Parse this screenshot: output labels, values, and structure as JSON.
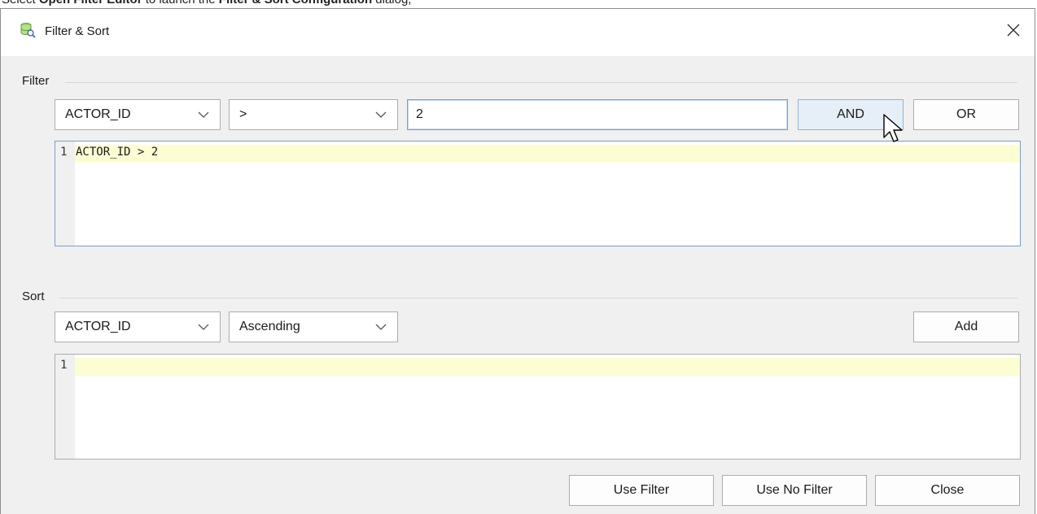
{
  "caption": {
    "prefix": "Select ",
    "bold1": "Open Filter Editor",
    "middle": " to launch the ",
    "bold2": "Filter & Sort Configuration",
    "suffix": " dialog,"
  },
  "dialog": {
    "title": "Filter & Sort",
    "title_icon": "filter-database-icon",
    "close_icon": "close-icon"
  },
  "filter": {
    "label": "Filter",
    "column_select": "ACTOR_ID",
    "operator_select": ">",
    "value_input": "2",
    "and_label": "AND",
    "or_label": "OR",
    "editor": {
      "lines": [
        {
          "num": "1",
          "text": "ACTOR_ID > 2"
        }
      ]
    }
  },
  "sort": {
    "label": "Sort",
    "column_select": "ACTOR_ID",
    "order_select": "Ascending",
    "add_label": "Add",
    "editor": {
      "lines": [
        {
          "num": "1",
          "text": ""
        }
      ]
    }
  },
  "footer": {
    "use_filter": "Use Filter",
    "use_no_filter": "Use No Filter",
    "close": "Close"
  },
  "colors": {
    "dialog_bg": "#f0f0f0",
    "line_highlight": "#fdfdd4",
    "focus_border": "#7a9ec9"
  }
}
